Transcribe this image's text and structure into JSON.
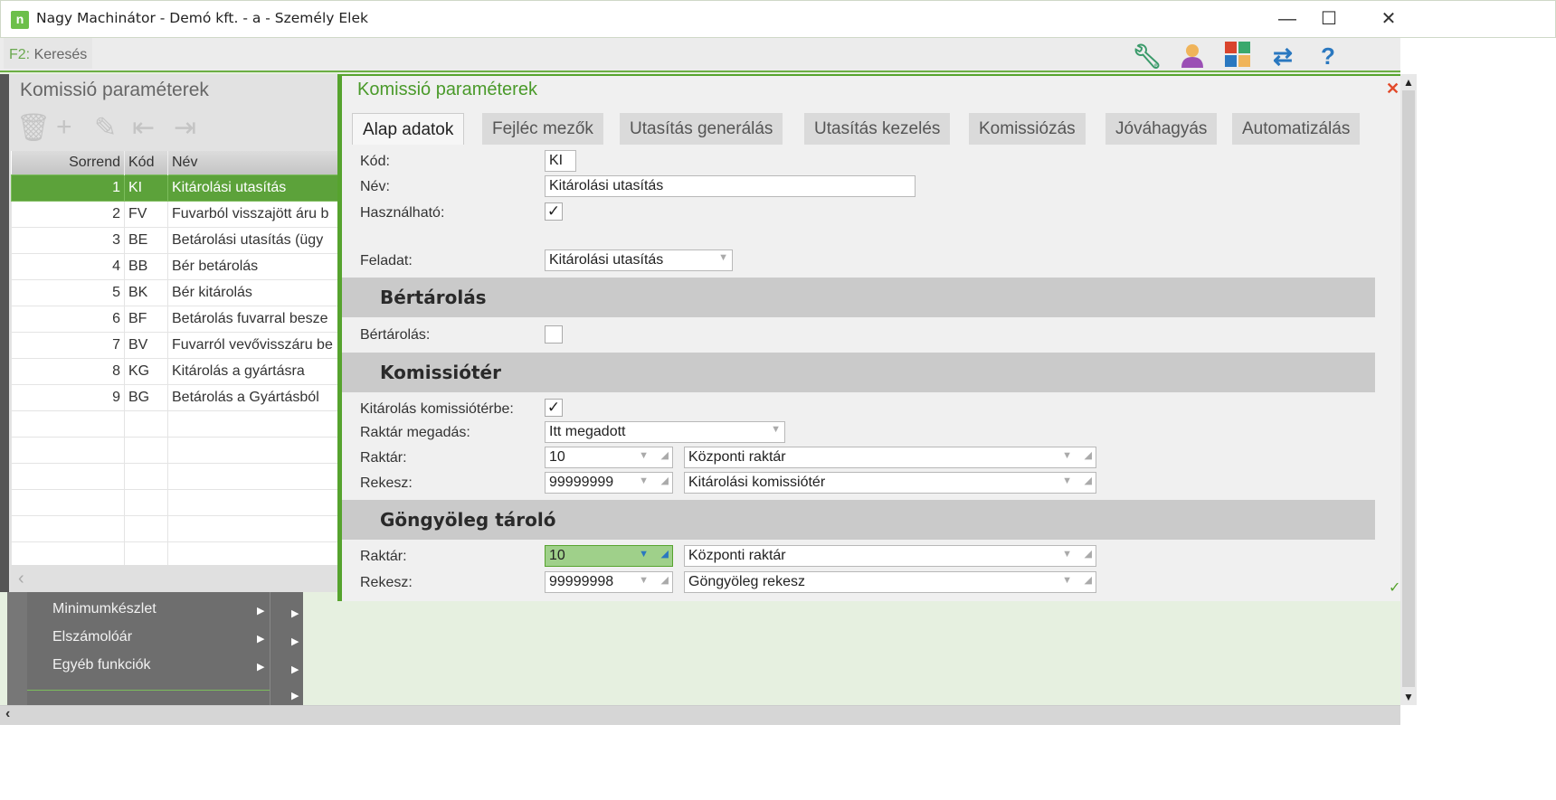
{
  "window": {
    "title": "Nagy Machinátor - Demó kft. - a - Személy Elek",
    "logo": "n",
    "minimize": "—",
    "maximize": "☐",
    "close": "✕"
  },
  "toolbar": {
    "shortcut_key": "F2:",
    "search_label": "Keresés",
    "icons": [
      "wrench-icon",
      "user-icon",
      "tiles-icon",
      "swap-icon",
      "help-icon"
    ]
  },
  "left_panel": {
    "title": "Komissió paraméterek",
    "columns": [
      "Sorrend",
      "Kód",
      "Név"
    ],
    "rows": [
      {
        "order": "1",
        "code": "KI",
        "name": "Kitárolási utasítás"
      },
      {
        "order": "2",
        "code": "FV",
        "name": "Fuvarból visszajött áru b"
      },
      {
        "order": "3",
        "code": "BE",
        "name": "Betárolási utasítás (ügy"
      },
      {
        "order": "4",
        "code": "BB",
        "name": "Bér betárolás"
      },
      {
        "order": "5",
        "code": "BK",
        "name": "Bér kitárolás"
      },
      {
        "order": "6",
        "code": "BF",
        "name": "Betárolás fuvarral besze"
      },
      {
        "order": "7",
        "code": "BV",
        "name": "Fuvarról vevővisszáru be"
      },
      {
        "order": "8",
        "code": "KG",
        "name": "Kitárolás a gyártásra"
      },
      {
        "order": "9",
        "code": "BG",
        "name": "Betárolás a Gyártásból"
      }
    ]
  },
  "menu": {
    "items": [
      "Minimumkészlet",
      "Elszámolóár",
      "Egyéb funkciók"
    ]
  },
  "dialog": {
    "title": "Komissió paraméterek",
    "tabs": [
      "Alap adatok",
      "Fejléc mezők",
      "Utasítás generálás",
      "Utasítás kezelés",
      "Komissiózás",
      "Jóváhagyás",
      "Automatizálás"
    ],
    "active_tab": "Alap adatok",
    "fields": {
      "kod_label": "Kód:",
      "kod": "KI",
      "nev_label": "Név:",
      "nev": "Kitárolási utasítás",
      "hasznalhato_label": "Használható:",
      "hasznalhato": true,
      "feladat_label": "Feladat:",
      "feladat": "Kitárolási utasítás"
    },
    "bertarolas": {
      "title": "Bértárolás",
      "label": "Bértárolás:",
      "checked": false
    },
    "komissioter": {
      "title": "Komissiótér",
      "kitarolas_label": "Kitárolás komissiótérbe:",
      "kitarolas": true,
      "raktar_megadas_label": "Raktár megadás:",
      "raktar_megadas": "Itt megadott",
      "raktar_label": "Raktár:",
      "raktar_code": "10",
      "raktar_name": "Központi raktár",
      "rekesz_label": "Rekesz:",
      "rekesz_code": "99999999",
      "rekesz_name": "Kitárolási komissiótér"
    },
    "gongyoleg": {
      "title": "Göngyöleg tároló",
      "raktar_label": "Raktár:",
      "raktar_code": "10",
      "raktar_name": "Központi raktár",
      "rekesz_label": "Rekesz:",
      "rekesz_code": "99999998",
      "rekesz_name": "Göngyöleg rekesz"
    }
  },
  "colors": {
    "accent": "#56a32e",
    "selected_row": "#5ca23a"
  }
}
